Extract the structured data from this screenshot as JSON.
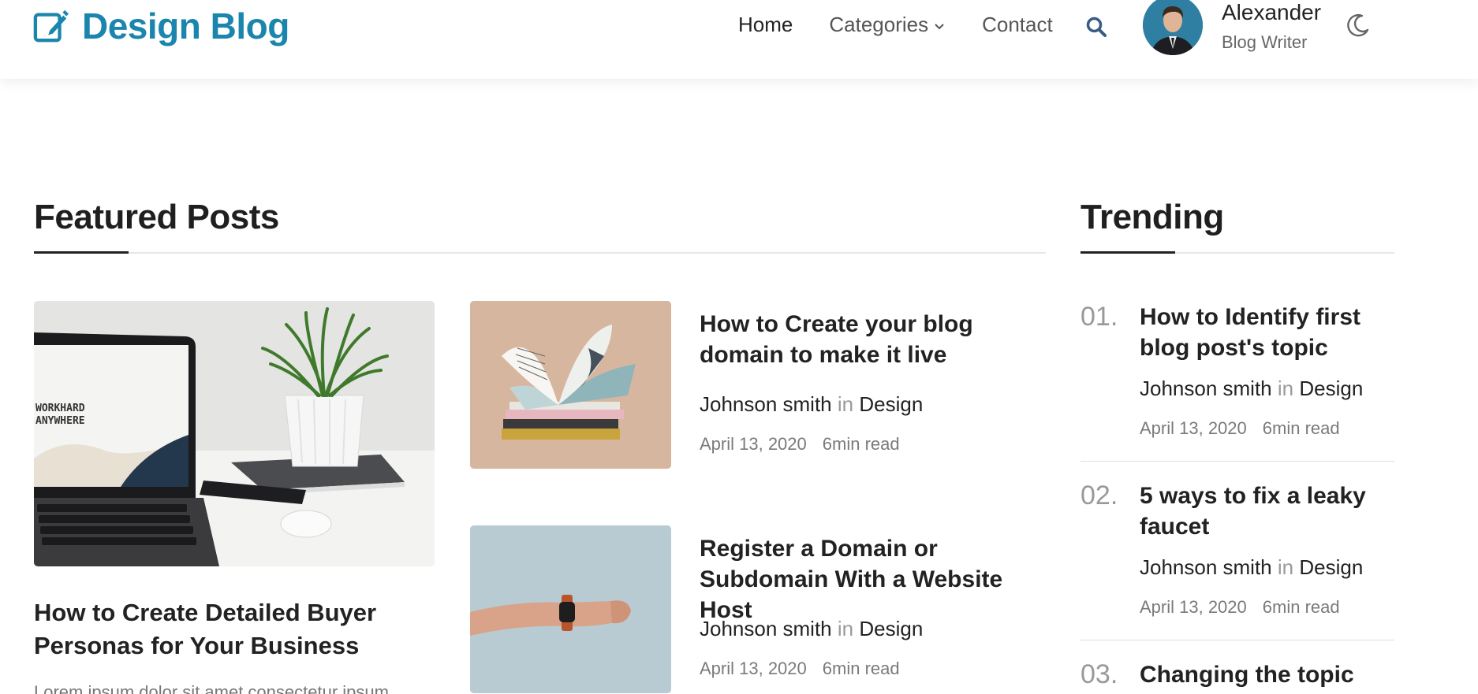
{
  "brand": {
    "name": "Design Blog",
    "icon": "edit-icon",
    "color": "#1b86ad"
  },
  "nav": {
    "items": [
      {
        "label": "Home",
        "active": true
      },
      {
        "label": "Categories",
        "has_dropdown": true
      },
      {
        "label": "Contact"
      }
    ],
    "search_icon": "search-icon"
  },
  "user": {
    "name": "Alexander",
    "role": "Blog Writer"
  },
  "theme_toggle": {
    "icon": "moon-icon"
  },
  "featured": {
    "heading": "Featured Posts",
    "main_post": {
      "title": "How to Create Detailed Buyer Personas for Your Business",
      "excerpt": "Lorem ipsum dolor sit amet consectetur ipsum",
      "image_text_line1": "WORKHARD",
      "image_text_line2": "ANYWHERE"
    },
    "side_posts": [
      {
        "title": "How to Create your blog domain to make it live",
        "author": "Johnson smith",
        "in_text": "in",
        "category": "Design",
        "date": "April 13, 2020",
        "read_time": "6min read"
      },
      {
        "title": "Register a Domain or Subdomain With a Website Host",
        "author": "Johnson smith",
        "in_text": "in",
        "category": "Design",
        "date": "April 13, 2020",
        "read_time": "6min read"
      }
    ]
  },
  "trending": {
    "heading": "Trending",
    "items": [
      {
        "number": "01.",
        "title": "How to Identify first blog post's topic",
        "author": "Johnson smith",
        "in_text": "in",
        "category": "Design",
        "date": "April 13, 2020",
        "read_time": "6min read"
      },
      {
        "number": "02.",
        "title": "5 ways to fix a leaky faucet",
        "author": "Johnson smith",
        "in_text": "in",
        "category": "Design",
        "date": "April 13, 2020",
        "read_time": "6min read"
      },
      {
        "number": "03.",
        "title": "Changing the topic"
      }
    ]
  }
}
